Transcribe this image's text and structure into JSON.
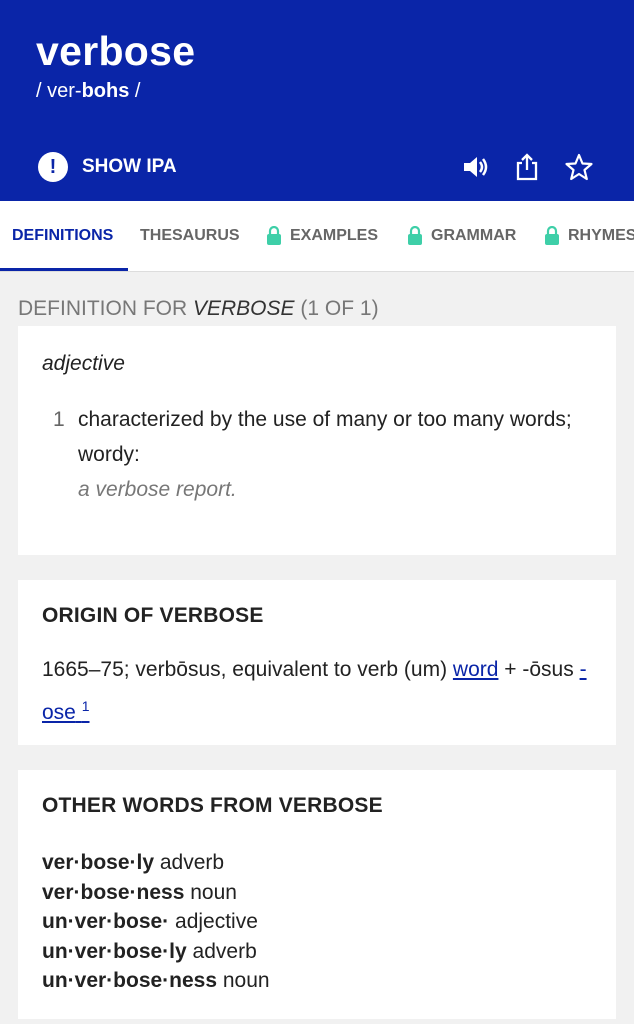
{
  "header": {
    "word": "verbose",
    "pron_prefix": "/ ver-",
    "pron_stress": "bohs",
    "pron_suffix": " /",
    "show_ipa_label": "SHOW IPA",
    "icons": [
      "exclamation-icon",
      "speaker-icon",
      "share-icon",
      "star-icon"
    ],
    "color": "#0a25a8"
  },
  "tabs": [
    {
      "label": "DEFINITIONS",
      "locked": false,
      "active": true
    },
    {
      "label": "THESAURUS",
      "locked": false,
      "active": false
    },
    {
      "label": "EXAMPLES",
      "locked": true,
      "active": false
    },
    {
      "label": "GRAMMAR",
      "locked": true,
      "active": false
    },
    {
      "label": "RHYMES",
      "locked": true,
      "active": false
    }
  ],
  "definition_section": {
    "prefix": "DEFINITION FOR ",
    "word": "VERBOSE",
    "count": " (1 OF 1)"
  },
  "definition_card": {
    "pos": "adjective",
    "number": "1",
    "text": "characterized by the use of many or too many words; wordy:",
    "example": "a verbose report."
  },
  "origin_card": {
    "heading": "ORIGIN OF VERBOSE",
    "text_before": "1665–75; verbōsus, equivalent to verb (um) ",
    "link1": "word",
    "text_mid": " + -ōsus ",
    "link2": "-ose",
    "link2_sup": "1"
  },
  "other_words_card": {
    "heading": "OTHER WORDS FROM VERBOSE",
    "items": [
      {
        "word": "ver·bose·ly",
        "pos": " adverb"
      },
      {
        "word": "ver·bose·ness",
        "pos": " noun"
      },
      {
        "word": "un·ver·bose·",
        "pos": " adjective"
      },
      {
        "word": "un·ver·bose·ly",
        "pos": " adverb"
      },
      {
        "word": "un·ver·bose·ness",
        "pos": " noun"
      }
    ]
  }
}
